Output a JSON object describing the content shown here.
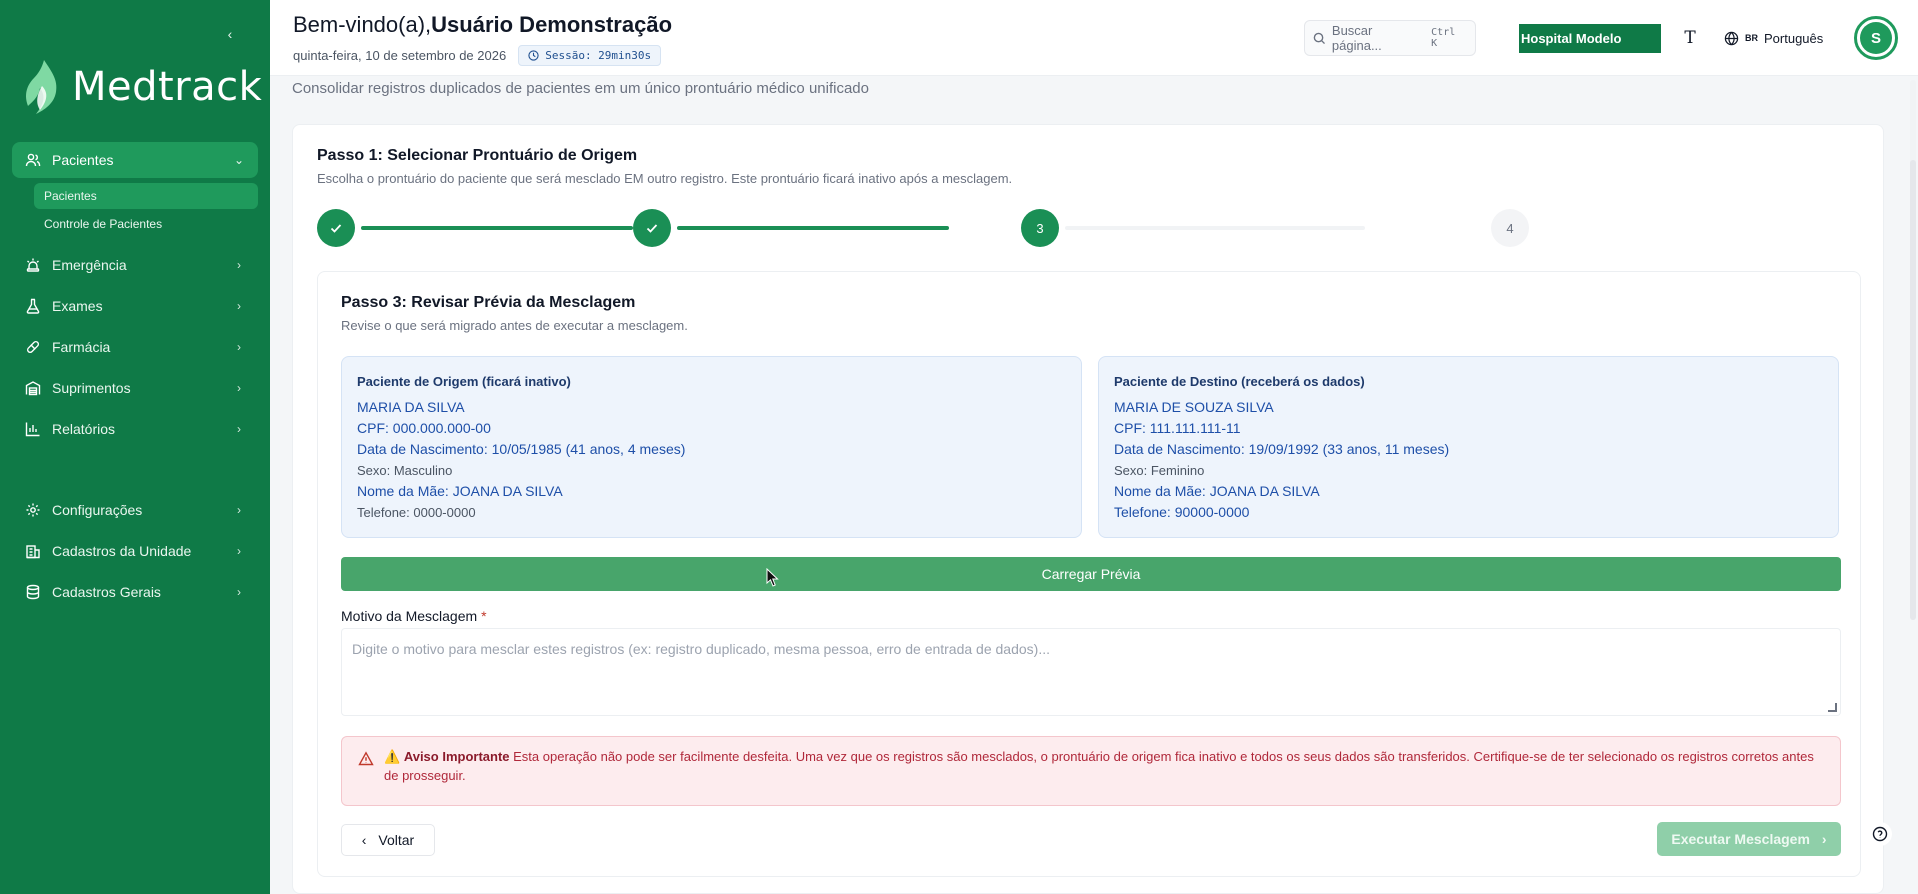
{
  "sidebar": {
    "brand": "Medtrack",
    "collapse_icon": "chevron-left-icon",
    "items": [
      {
        "label": "Pacientes",
        "icon": "users-icon",
        "active": true,
        "expanded": true,
        "subitems": [
          {
            "label": "Pacientes",
            "active": true
          },
          {
            "label": "Controle de Pacientes",
            "active": false
          }
        ]
      },
      {
        "label": "Emergência",
        "icon": "siren-icon"
      },
      {
        "label": "Exames",
        "icon": "flask-icon"
      },
      {
        "label": "Farmácia",
        "icon": "pill-icon"
      },
      {
        "label": "Suprimentos",
        "icon": "warehouse-icon"
      },
      {
        "label": "Relatórios",
        "icon": "bar-chart-icon"
      },
      {
        "label": "Configurações",
        "icon": "gear-icon"
      },
      {
        "label": "Cadastros da Unidade",
        "icon": "building-icon"
      },
      {
        "label": "Cadastros Gerais",
        "icon": "database-icon"
      }
    ]
  },
  "header": {
    "welcome_prefix": "Bem-vindo(a),",
    "user_name": "Usuário Demonstração",
    "date": "quinta-feira, 10 de setembro de 2026",
    "session": "Sessão: 29min30s",
    "search_placeholder": "Buscar página...",
    "search_shortcut": "Ctrl K",
    "hospital": "Hospital Modelo",
    "text_size_glyph": "T",
    "language_flag": "BR",
    "language": "Português",
    "avatar_initial": "S"
  },
  "page": {
    "subtitle": "Consolidar registros duplicados de pacientes em um único prontuário médico unificado"
  },
  "step1": {
    "title": "Passo 1: Selecionar Prontuário de Origem",
    "description": "Escolha o prontuário do paciente que será mesclado EM outro registro. Este prontuário ficará inativo após a mesclagem."
  },
  "stepper": {
    "steps": [
      {
        "label": "✓",
        "state": "done"
      },
      {
        "label": "✓",
        "state": "done"
      },
      {
        "label": "3",
        "state": "current"
      },
      {
        "label": "4",
        "state": "pending"
      }
    ]
  },
  "step3": {
    "title": "Passo 3: Revisar Prévia da Mesclagem",
    "description": "Revise o que será migrado antes de executar a mesclagem.",
    "origin": {
      "title": "Paciente de Origem (ficará inativo)",
      "name": "MARIA DA SILVA",
      "cpf": "CPF: 000.000.000-00",
      "birth": "Data de Nascimento: 10/05/1985 (41 anos, 4 meses)",
      "sex": "Sexo: Masculino",
      "mother": "Nome da Mãe: JOANA DA SILVA",
      "phone": "Telefone: 0000-0000"
    },
    "destination": {
      "title": "Paciente de Destino (receberá os dados)",
      "name": "MARIA DE SOUZA SILVA",
      "cpf": "CPF: 111.111.111-11",
      "birth": "Data de Nascimento: 19/09/1992 (33 anos, 11 meses)",
      "sex": "Sexo: Feminino",
      "mother": "Nome da Mãe: JOANA DA SILVA",
      "phone": "Telefone: 90000-0000"
    },
    "load_preview": "Carregar Prévia",
    "reason_label": "Motivo da Mesclagem",
    "reason_required": "*",
    "reason_placeholder": "Digite o motivo para mesclar estes registros (ex: registro duplicado, mesma pessoa, erro de entrada de dados)...",
    "warning_title": "Aviso Importante",
    "warning_text": "Esta operação não pode ser facilmente desfeita. Uma vez que os registros são mesclados, o prontuário de origem fica inativo e todos os seus dados são transferidos. Certifique-se de ter selecionado os registros corretos antes de prosseguir.",
    "back": "Voltar",
    "execute": "Executar Mesclagem"
  },
  "colors": {
    "sidebar": "#0f7a47",
    "accent": "#1a8f55",
    "load_button": "#48a56b",
    "execute_disabled": "#8fcfa9",
    "warning_bg": "#fdecee",
    "patient_box_bg": "#eef4fc"
  }
}
